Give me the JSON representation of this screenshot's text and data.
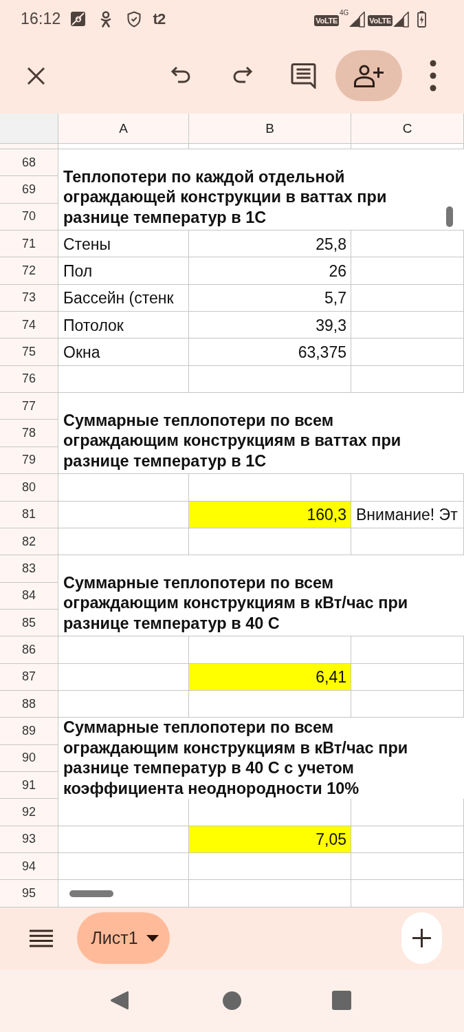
{
  "status_bar": {
    "time": "16:12",
    "carrier": "t2",
    "sims": [
      {
        "badge": "VoLTE",
        "network": "4G"
      },
      {
        "badge": "VoLTE"
      }
    ]
  },
  "sheet": {
    "columns": [
      "A",
      "B",
      "C"
    ],
    "rows": [
      {
        "kind": "merged",
        "numbers": [
          "68",
          "69",
          "70"
        ],
        "text": "Теплопотери по каждой отдельной ограждающей конструкции в ваттах при разнице температур в 1С"
      },
      {
        "kind": "row",
        "number": "71",
        "cells": [
          {
            "text": "Стены",
            "highlighted": false
          },
          {
            "text": "25,8",
            "highlighted": false
          },
          {
            "highlighted": false
          }
        ]
      },
      {
        "kind": "row",
        "number": "72",
        "cells": [
          {
            "text": "Пол",
            "highlighted": false
          },
          {
            "text": "26",
            "highlighted": false
          },
          {
            "highlighted": false
          }
        ]
      },
      {
        "kind": "row",
        "number": "73",
        "cells": [
          {
            "text": "Бассейн (стенк",
            "highlighted": false
          },
          {
            "text": "5,7",
            "highlighted": false
          },
          {
            "highlighted": false
          }
        ]
      },
      {
        "kind": "row",
        "number": "74",
        "cells": [
          {
            "text": "Потолок",
            "highlighted": false
          },
          {
            "text": "39,3",
            "highlighted": false
          },
          {
            "highlighted": false
          }
        ]
      },
      {
        "kind": "row",
        "number": "75",
        "cells": [
          {
            "text": "Окна",
            "highlighted": false
          },
          {
            "text": "63,375",
            "highlighted": false
          },
          {
            "highlighted": false
          }
        ]
      },
      {
        "kind": "row",
        "number": "76",
        "cells": [
          {
            "highlighted": false
          },
          {
            "highlighted": false
          },
          {
            "highlighted": false
          }
        ]
      },
      {
        "kind": "merged",
        "numbers": [
          "77",
          "78",
          "79"
        ],
        "text": "Суммарные теплопотери по всем ограждающим конструкциям в ваттах при разнице температур в 1С"
      },
      {
        "kind": "row",
        "number": "80",
        "cells": [
          {
            "highlighted": false
          },
          {
            "highlighted": false
          },
          {
            "highlighted": false
          }
        ]
      },
      {
        "kind": "row",
        "number": "81",
        "cells": [
          {
            "highlighted": false
          },
          {
            "text": "160,3",
            "highlighted": true
          },
          {
            "text": "Внимание! Эт",
            "highlighted": false
          }
        ]
      },
      {
        "kind": "row",
        "number": "82",
        "cells": [
          {
            "highlighted": false
          },
          {
            "highlighted": false
          },
          {
            "highlighted": false
          }
        ]
      },
      {
        "kind": "merged",
        "numbers": [
          "83",
          "84",
          "85"
        ],
        "text": "Суммарные теплопотери по всем ограждающим конструкциям в кВт/час при разнице температур в 40 С"
      },
      {
        "kind": "row",
        "number": "86",
        "cells": [
          {
            "highlighted": false
          },
          {
            "highlighted": false
          },
          {
            "highlighted": false
          }
        ]
      },
      {
        "kind": "row",
        "number": "87",
        "cells": [
          {
            "highlighted": false
          },
          {
            "text": "6,41",
            "highlighted": true
          },
          {
            "highlighted": false
          }
        ]
      },
      {
        "kind": "row",
        "number": "88",
        "cells": [
          {
            "highlighted": false
          },
          {
            "highlighted": false
          },
          {
            "highlighted": false
          }
        ]
      },
      {
        "kind": "merged",
        "numbers": [
          "89",
          "90",
          "91"
        ],
        "text": "Суммарные теплопотери по всем ограждающим конструкциям в кВт/час при разнице температур в 40 С с учетом коэффициента неоднородности 10%"
      },
      {
        "kind": "row",
        "number": "92",
        "cells": [
          {
            "highlighted": false
          },
          {
            "highlighted": false
          },
          {
            "highlighted": false
          }
        ]
      },
      {
        "kind": "row",
        "number": "93",
        "cells": [
          {
            "highlighted": false
          },
          {
            "text": "7,05",
            "highlighted": true
          },
          {
            "highlighted": false
          }
        ]
      },
      {
        "kind": "row",
        "number": "94",
        "cells": [
          {
            "highlighted": false
          },
          {
            "highlighted": false
          },
          {
            "highlighted": false
          }
        ]
      },
      {
        "kind": "row",
        "number": "95",
        "cells": [
          {
            "highlighted": false
          },
          {
            "highlighted": false
          },
          {
            "highlighted": false
          }
        ]
      }
    ]
  },
  "sheet_tabs": [
    {
      "label": "Лист1",
      "selected": true
    }
  ]
}
